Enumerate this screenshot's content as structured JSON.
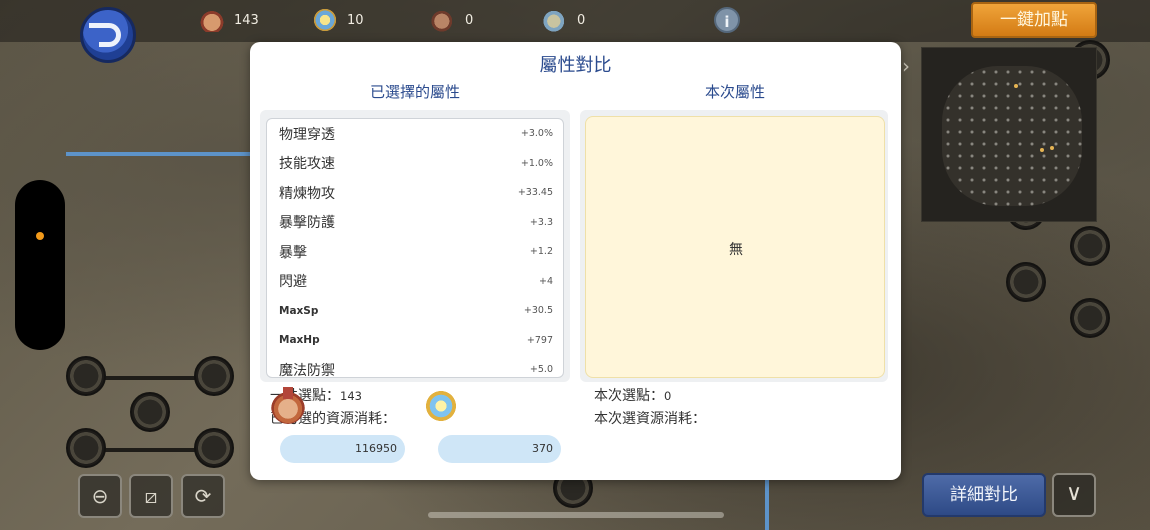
{
  "top_resources": [
    {
      "icon": "medal-icon",
      "value": "143"
    },
    {
      "icon": "crystal-icon",
      "value": "10"
    },
    {
      "icon": "locked-medal-icon",
      "value": "0"
    },
    {
      "icon": "locked-crystal-icon",
      "value": "0"
    }
  ],
  "info_label": "i",
  "one_click_label": "一鍵加點",
  "detail_compare_label": "詳細對比",
  "expand_icon": "∨",
  "modal": {
    "title": "屬性對比",
    "left_header": "已選擇的屬性",
    "right_header": "本次屬性",
    "attributes": [
      {
        "name": "物理穿透",
        "value": "+3.0%"
      },
      {
        "name": "技能攻速",
        "value": "+1.0%"
      },
      {
        "name": "精煉物攻",
        "value": "+33.45"
      },
      {
        "name": "暴擊防護",
        "value": "+3.3"
      },
      {
        "name": "暴擊",
        "value": "+1.2"
      },
      {
        "name": "閃避",
        "value": "+4"
      },
      {
        "name": "MaxSp",
        "value": "+30.5"
      },
      {
        "name": "MaxHp",
        "value": "+797"
      },
      {
        "name": "魔法防禦",
        "value": "+5.0"
      }
    ],
    "none_text": "無",
    "total_points_label": "一共選點：",
    "total_points_value": "143",
    "checked_cost_label": "已勾選的資源消耗：",
    "current_points_label": "本次選點：",
    "current_points_value": "0",
    "current_cost_label": "本次選資源消耗：",
    "costs": [
      {
        "icon": "medal-icon",
        "value": "116950"
      },
      {
        "icon": "crystal-icon",
        "value": "370"
      }
    ]
  },
  "colors": {
    "title_blue": "#2b4b8e",
    "orange_button": "#e08c22",
    "blue_button": "#3e5c98",
    "panel_yellow": "#fff6da",
    "cost_pill": "#cfe6f7"
  }
}
